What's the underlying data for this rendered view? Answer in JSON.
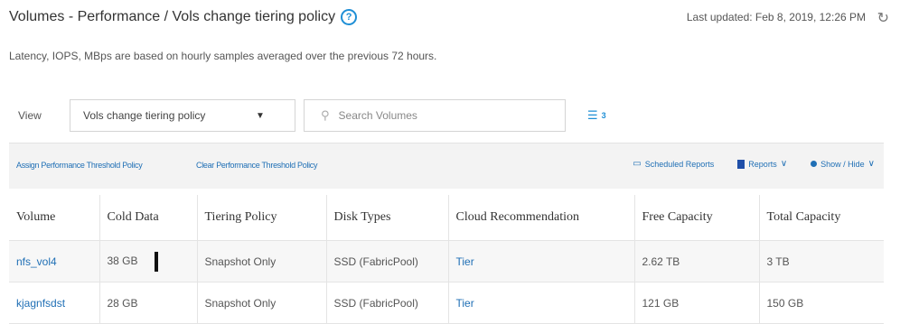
{
  "header": {
    "title": "Volumes - Performance / Vols change tiering policy",
    "help_glyph": "?",
    "last_updated": "Last updated: Feb 8, 2019, 12:26 PM",
    "refresh_glyph": "↻"
  },
  "subtitle": "Latency, IOPS, MBps are based on hourly samples averaged over the previous 72 hours.",
  "toolbar": {
    "view_label": "View",
    "view_value": "Vols change tiering policy",
    "view_chevron": "▼",
    "search_placeholder": "Search Volumes",
    "search_glyph": "⚲",
    "filter_glyph": "☰",
    "filter_count": "3"
  },
  "actions": {
    "assign": "Assign Performance Threshold Policy",
    "clear": "Clear Performance Threshold Policy",
    "scheduled_reports": "Scheduled Reports",
    "calendar_glyph": "▭",
    "reports": "Reports",
    "show_hide": "Show / Hide",
    "chevron": "∨"
  },
  "table": {
    "columns": [
      "Volume",
      "Cold Data",
      "Tiering Policy",
      "Disk Types",
      "Cloud Recommendation",
      "Free Capacity",
      "Total Capacity"
    ],
    "rows": [
      {
        "volume": "nfs_vol4",
        "cold_data": "38 GB",
        "tiering_policy": "Snapshot Only",
        "disk_types": "SSD (FabricPool)",
        "cloud_rec": "Tier",
        "free_capacity": "2.62 TB",
        "total_capacity": "3 TB"
      },
      {
        "volume": "kjagnfsdst",
        "cold_data": "28 GB",
        "tiering_policy": "Snapshot Only",
        "disk_types": "SSD (FabricPool)",
        "cloud_rec": "Tier",
        "free_capacity": "121 GB",
        "total_capacity": "150 GB"
      }
    ]
  },
  "colors": {
    "link": "#1f6fb5",
    "accent": "#1f8fd6"
  }
}
